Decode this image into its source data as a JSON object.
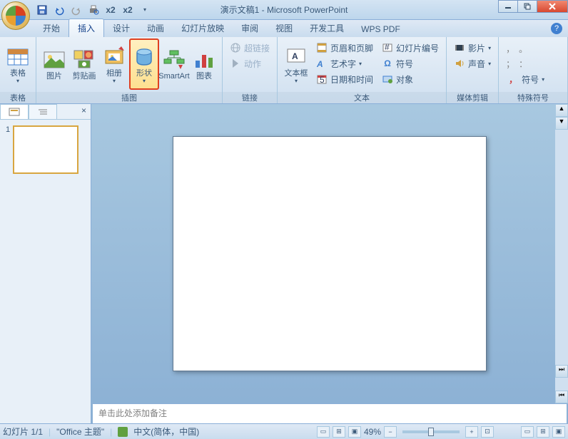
{
  "title": "演示文稿1 - Microsoft PowerPoint",
  "qat": {
    "save": "save",
    "undo": "undo",
    "redo": "redo",
    "print": "print"
  },
  "tabs": {
    "home": "开始",
    "insert": "插入",
    "design": "设计",
    "animations": "动画",
    "slideshow": "幻灯片放映",
    "review": "审阅",
    "view": "视图",
    "developer": "开发工具",
    "wps": "WPS PDF"
  },
  "ribbon": {
    "tables": {
      "label": "表格",
      "table": "表格"
    },
    "illustrations": {
      "label": "插图",
      "picture": "图片",
      "clipart": "剪贴画",
      "album": "相册",
      "shapes": "形状",
      "smartart": "SmartArt",
      "chart": "图表"
    },
    "links": {
      "label": "链接",
      "hyperlink": "超链接",
      "action": "动作"
    },
    "text": {
      "label": "文本",
      "textbox": "文本框",
      "header_footer": "页眉和页脚",
      "wordart": "艺术字",
      "datetime": "日期和时间",
      "slide_number": "幻灯片编号",
      "symbol": "符号",
      "object": "对象"
    },
    "media": {
      "label": "媒体剪辑",
      "movie": "影片",
      "sound": "声音"
    },
    "special": {
      "label": "特殊符号",
      "symbols": "符号"
    }
  },
  "notes_placeholder": "单击此处添加备注",
  "status": {
    "slide_info": "幻灯片 1/1",
    "theme": "\"Office 主题\"",
    "language": "中文(简体，中国)",
    "zoom": "49%"
  },
  "slide_number": "1"
}
